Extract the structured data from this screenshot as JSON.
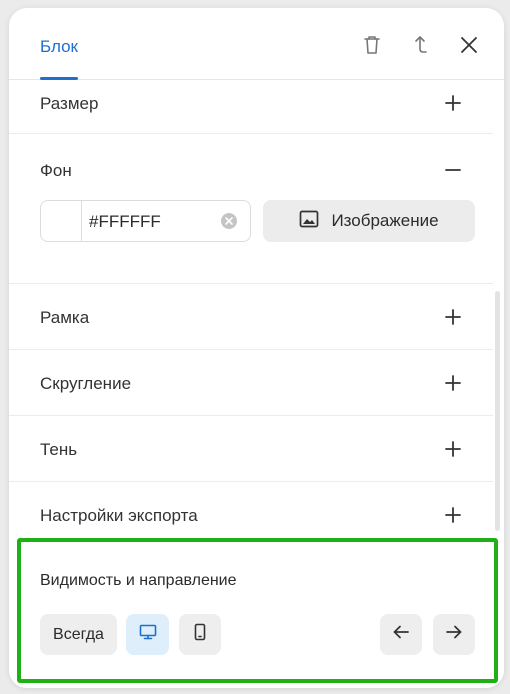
{
  "header": {
    "active_tab": "Блок",
    "icons": [
      "trash-icon",
      "arrow-up-icon",
      "close-icon"
    ]
  },
  "sections": [
    {
      "label": "Размер",
      "state": "collapsed"
    },
    {
      "label": "Фон",
      "state": "expanded"
    },
    {
      "label": "Рамка",
      "state": "collapsed"
    },
    {
      "label": "Скругление",
      "state": "collapsed"
    },
    {
      "label": "Тень",
      "state": "collapsed"
    },
    {
      "label": "Настройки экспорта",
      "state": "collapsed"
    }
  ],
  "background": {
    "color_value": "#FFFFFF",
    "image_button": "Изображение"
  },
  "visibility": {
    "title": "Видимость и направление",
    "always_label": "Всегда",
    "selected_device": "desktop",
    "buttons": [
      "desktop-icon",
      "mobile-icon",
      "arrow-left-icon",
      "arrow-right-icon"
    ]
  },
  "colors": {
    "accent": "#1f6fd0",
    "highlight_frame": "#1fb014",
    "active_button_bg": "#dfeefb"
  }
}
